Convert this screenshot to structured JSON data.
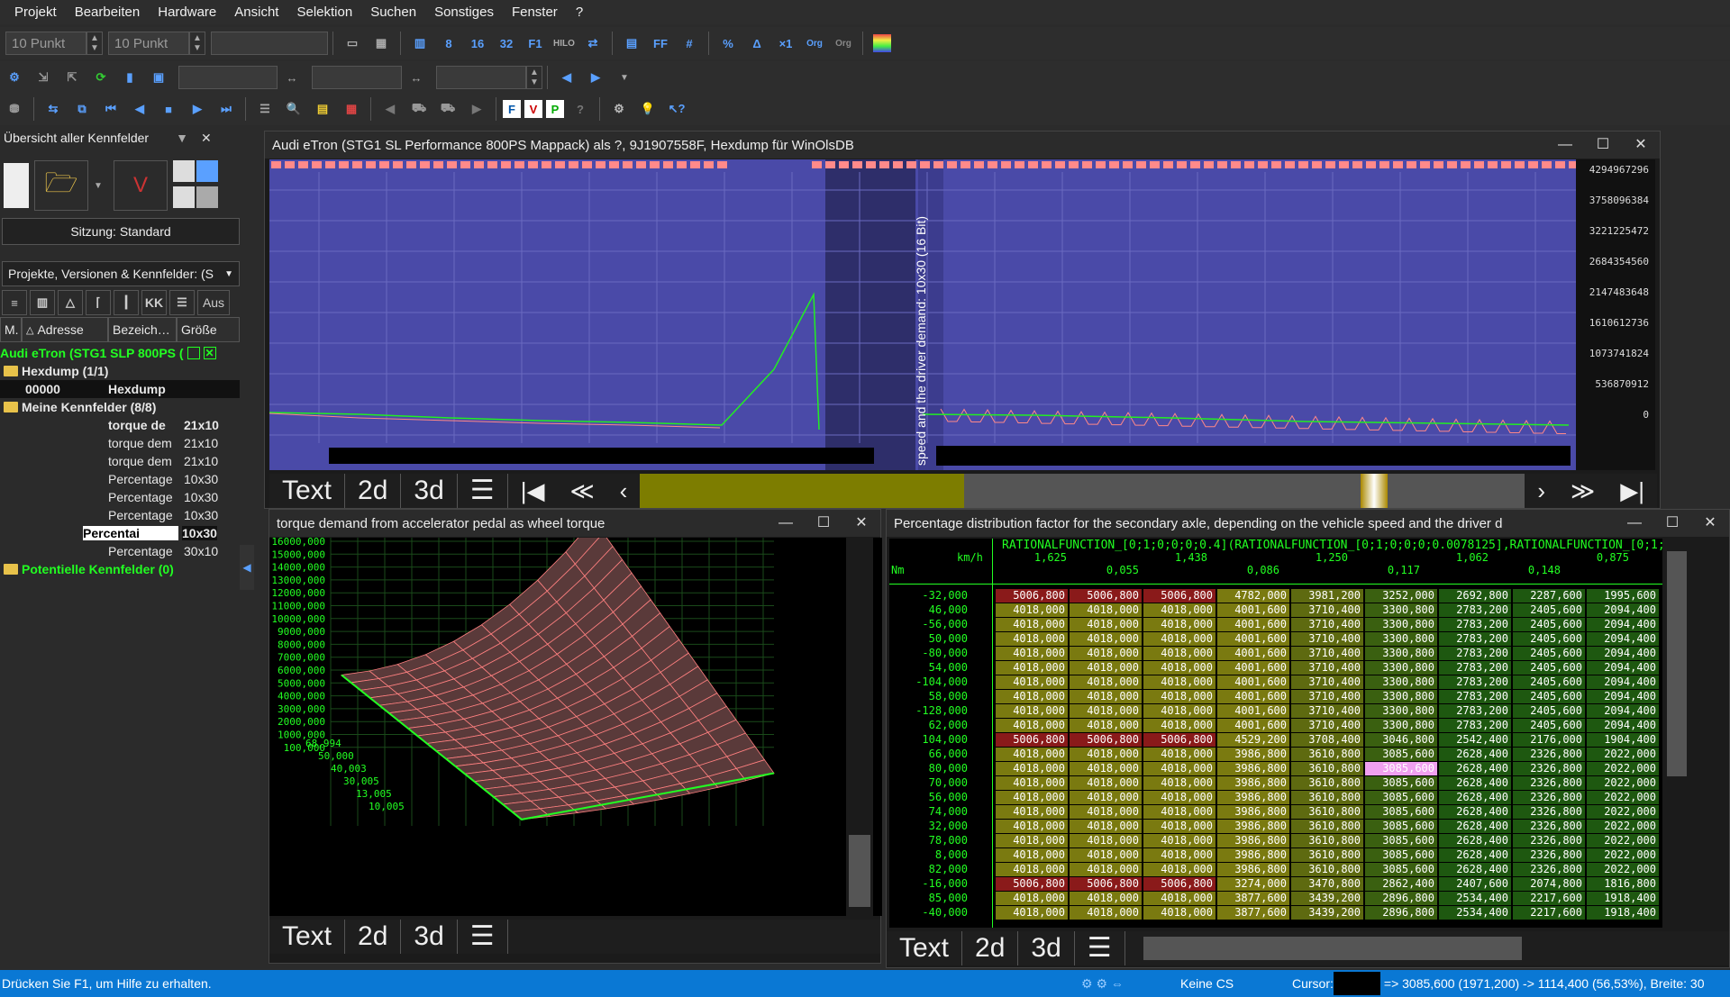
{
  "menu": [
    "Projekt",
    "Bearbeiten",
    "Hardware",
    "Ansicht",
    "Selektion",
    "Suchen",
    "Sonstiges",
    "Fenster",
    "?"
  ],
  "toolbar": {
    "font1": "10 Punkt",
    "font2": "10 Punkt"
  },
  "left_panel": {
    "title": "Übersicht aller Kennfelder",
    "session": "Sitzung: Standard",
    "dropdown": "Projekte, Versionen & Kennfelder: (S",
    "aus_label": "Aus",
    "columns": [
      "M.",
      "Adresse",
      "Bezeich…",
      "Größe"
    ],
    "project": "Audi eTron (STG1 SLP 800PS (",
    "hexdump_folder": "Hexdump (1/1)",
    "hexdump_addr": "00000",
    "hexdump_name": "Hexdump",
    "maps_folder": "Meine Kennfelder (8/8)",
    "maps": [
      {
        "name": "torque de",
        "size": "21x10",
        "bold": true
      },
      {
        "name": "torque dem",
        "size": "21x10",
        "bold": false
      },
      {
        "name": "torque dem",
        "size": "21x10",
        "bold": false
      },
      {
        "name": "Percentage",
        "size": "10x30",
        "bold": false
      },
      {
        "name": "Percentage",
        "size": "10x30",
        "bold": false
      },
      {
        "name": "Percentage",
        "size": "10x30",
        "bold": false
      },
      {
        "name": "Percentai",
        "size": "10x30",
        "bold": true
      },
      {
        "name": "Percentage",
        "size": "30x10",
        "bold": false
      }
    ],
    "potential": "Potentielle Kennfelder (0)"
  },
  "hexwin": {
    "title": "Audi eTron (STG1 SL Performance 800PS Mappack) als ?, 9J1907558F, Hexdump für WinOlsDB",
    "vertical_label": "speed and the driver demand: 10x30 (16 Bit)",
    "yticks": [
      "4294967296",
      "3758096384",
      "3221225472",
      "2684354560",
      "2147483648",
      "1610612736",
      "1073741824",
      "536870912",
      "0"
    ],
    "tabs": [
      "Text",
      "2d",
      "3d"
    ]
  },
  "win3d": {
    "title": "torque demand from accelerator pedal as wheel torque",
    "zticks": [
      "16000,000",
      "15000,000",
      "14000,000",
      "13000,000",
      "12000,000",
      "11000,000",
      "10000,000",
      "9000,000",
      "8000,000",
      "7000,000",
      "6000,000",
      "5000,000",
      "4000,000",
      "3000,000",
      "2000,000",
      "1000,000",
      "100,000"
    ],
    "axis_labels": [
      "68,994",
      "50,000",
      "40,003",
      "30,005",
      "13,005",
      "10,005"
    ],
    "tabs": [
      "Text",
      "2d",
      "3d"
    ]
  },
  "tablewin": {
    "title": "Percentage distribution factor for the secondary axle, depending on the vehicle speed and the driver d",
    "rational": "RATIONALFUNCTION_[0;1;0;0;0;0.4](RATIONALFUNCTION_[0;1;0;0;0;0.0078125],RATIONALFUNCTION_[0;1;0",
    "unit_x": "km/h",
    "unit_y": "Nm",
    "col_top": [
      "1,625",
      "1,438",
      "1,250",
      "1,062",
      "0,875"
    ],
    "col_bot": [
      "0,055",
      "0,086",
      "0,117",
      "0,148"
    ],
    "rows": [
      [
        "-32,000",
        "5006,800",
        "5006,800",
        "5006,800",
        "4782,000",
        "3981,200",
        "3252,000",
        "2692,800",
        "2287,600",
        "1995,600"
      ],
      [
        "46,000",
        "4018,000",
        "4018,000",
        "4018,000",
        "4001,600",
        "3710,400",
        "3300,800",
        "2783,200",
        "2405,600",
        "2094,400"
      ],
      [
        "-56,000",
        "4018,000",
        "4018,000",
        "4018,000",
        "4001,600",
        "3710,400",
        "3300,800",
        "2783,200",
        "2405,600",
        "2094,400"
      ],
      [
        "50,000",
        "4018,000",
        "4018,000",
        "4018,000",
        "4001,600",
        "3710,400",
        "3300,800",
        "2783,200",
        "2405,600",
        "2094,400"
      ],
      [
        "-80,000",
        "4018,000",
        "4018,000",
        "4018,000",
        "4001,600",
        "3710,400",
        "3300,800",
        "2783,200",
        "2405,600",
        "2094,400"
      ],
      [
        "54,000",
        "4018,000",
        "4018,000",
        "4018,000",
        "4001,600",
        "3710,400",
        "3300,800",
        "2783,200",
        "2405,600",
        "2094,400"
      ],
      [
        "-104,000",
        "4018,000",
        "4018,000",
        "4018,000",
        "4001,600",
        "3710,400",
        "3300,800",
        "2783,200",
        "2405,600",
        "2094,400"
      ],
      [
        "58,000",
        "4018,000",
        "4018,000",
        "4018,000",
        "4001,600",
        "3710,400",
        "3300,800",
        "2783,200",
        "2405,600",
        "2094,400"
      ],
      [
        "-128,000",
        "4018,000",
        "4018,000",
        "4018,000",
        "4001,600",
        "3710,400",
        "3300,800",
        "2783,200",
        "2405,600",
        "2094,400"
      ],
      [
        "62,000",
        "4018,000",
        "4018,000",
        "4018,000",
        "4001,600",
        "3710,400",
        "3300,800",
        "2783,200",
        "2405,600",
        "2094,400"
      ],
      [
        "104,000",
        "5006,800",
        "5006,800",
        "5006,800",
        "4529,200",
        "3708,400",
        "3046,800",
        "2542,400",
        "2176,000",
        "1904,400"
      ],
      [
        "66,000",
        "4018,000",
        "4018,000",
        "4018,000",
        "3986,800",
        "3610,800",
        "3085,600",
        "2628,400",
        "2326,800",
        "2022,000"
      ],
      [
        "80,000",
        "4018,000",
        "4018,000",
        "4018,000",
        "3986,800",
        "3610,800",
        "3085,600",
        "2628,400",
        "2326,800",
        "2022,000"
      ],
      [
        "70,000",
        "4018,000",
        "4018,000",
        "4018,000",
        "3986,800",
        "3610,800",
        "3085,600",
        "2628,400",
        "2326,800",
        "2022,000"
      ],
      [
        "56,000",
        "4018,000",
        "4018,000",
        "4018,000",
        "3986,800",
        "3610,800",
        "3085,600",
        "2628,400",
        "2326,800",
        "2022,000"
      ],
      [
        "74,000",
        "4018,000",
        "4018,000",
        "4018,000",
        "3986,800",
        "3610,800",
        "3085,600",
        "2628,400",
        "2326,800",
        "2022,000"
      ],
      [
        "32,000",
        "4018,000",
        "4018,000",
        "4018,000",
        "3986,800",
        "3610,800",
        "3085,600",
        "2628,400",
        "2326,800",
        "2022,000"
      ],
      [
        "78,000",
        "4018,000",
        "4018,000",
        "4018,000",
        "3986,800",
        "3610,800",
        "3085,600",
        "2628,400",
        "2326,800",
        "2022,000"
      ],
      [
        "8,000",
        "4018,000",
        "4018,000",
        "4018,000",
        "3986,800",
        "3610,800",
        "3085,600",
        "2628,400",
        "2326,800",
        "2022,000"
      ],
      [
        "82,000",
        "4018,000",
        "4018,000",
        "4018,000",
        "3986,800",
        "3610,800",
        "3085,600",
        "2628,400",
        "2326,800",
        "2022,000"
      ],
      [
        "-16,000",
        "5006,800",
        "5006,800",
        "5006,800",
        "3274,000",
        "3470,800",
        "2862,400",
        "2407,600",
        "2074,800",
        "1816,800"
      ],
      [
        "85,000",
        "4018,000",
        "4018,000",
        "4018,000",
        "3877,600",
        "3439,200",
        "2896,800",
        "2534,400",
        "2217,600",
        "1918,400"
      ],
      [
        "-40,000",
        "4018,000",
        "4018,000",
        "4018,000",
        "3877,600",
        "3439,200",
        "2896,800",
        "2534,400",
        "2217,600",
        "1918,400"
      ]
    ],
    "selected": "3085,600",
    "tabs": [
      "Text",
      "2d",
      "3d"
    ]
  },
  "status": {
    "help": "Drücken Sie F1, um Hilfe zu erhalten.",
    "cs": "Keine CS",
    "cursor_label": "Cursor:",
    "cursor_info": "=> 3085,600 (1971,200) -> 1114,400 (56,53%), Breite: 30"
  },
  "colors": {
    "accent": "#0a78d4",
    "plot_bg": "#4a4aa8",
    "cell_green": "#7a8a18",
    "cell_red": "#8a1a1a",
    "green": "#22ff22"
  }
}
